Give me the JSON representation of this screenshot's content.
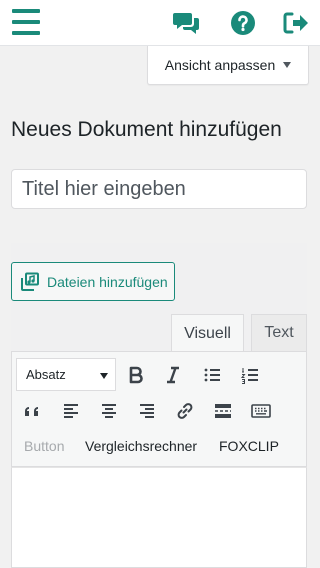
{
  "header": {
    "menu_icon": "hamburger-menu-icon",
    "icons": [
      "chat-bubbles-icon",
      "help-circle-icon",
      "logout-icon"
    ],
    "accent_color": "#1a8a7a"
  },
  "screen_options": {
    "label": "Ansicht anpassen"
  },
  "page": {
    "title": "Neues Dokument hinzufügen"
  },
  "title_field": {
    "placeholder": "Titel hier eingeben",
    "value": ""
  },
  "media": {
    "add_files_label": "Dateien hinzufügen"
  },
  "editor": {
    "tabs": {
      "visual": "Visuell",
      "text": "Text"
    },
    "active_tab": "Visuell",
    "format_select": {
      "selected": "Absatz"
    },
    "toolbar_text_buttons": {
      "button": "Button",
      "comparison": "Vergleichsrechner",
      "foxclip": "FOXCLIP"
    }
  }
}
